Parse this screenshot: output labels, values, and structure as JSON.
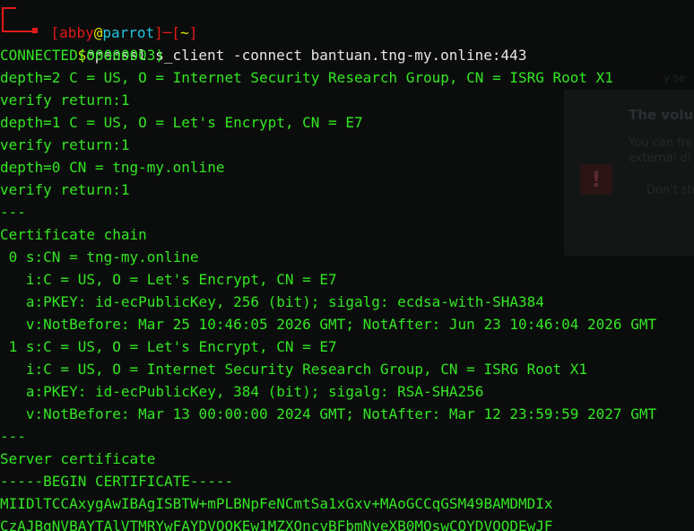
{
  "prompt": {
    "user": "abby",
    "at": "@",
    "host": "parrot",
    "dir": "~",
    "symbol": "$",
    "command": "openssl s_client -connect bantuan.tng-my.online:443"
  },
  "output": [
    "CONNECTED(00000003)",
    "depth=2 C = US, O = Internet Security Research Group, CN = ISRG Root X1",
    "verify return:1",
    "depth=1 C = US, O = Let's Encrypt, CN = E7",
    "verify return:1",
    "depth=0 CN = tng-my.online",
    "verify return:1",
    "---",
    "Certificate chain",
    " 0 s:CN = tng-my.online",
    "   i:C = US, O = Let's Encrypt, CN = E7",
    "   a:PKEY: id-ecPublicKey, 256 (bit); sigalg: ecdsa-with-SHA384",
    "   v:NotBefore: Mar 25 10:46:05 2026 GMT; NotAfter: Jun 23 10:46:04 2026 GMT",
    " 1 s:C = US, O = Let's Encrypt, CN = E7",
    "   i:C = US, O = Internet Security Research Group, CN = ISRG Root X1",
    "   a:PKEY: id-ecPublicKey, 384 (bit); sigalg: RSA-SHA256",
    "   v:NotBefore: Mar 13 00:00:00 2024 GMT; NotAfter: Mar 12 23:59:59 2027 GMT",
    "---",
    "Server certificate",
    "-----BEGIN CERTIFICATE-----",
    "MIIDlTCCAxygAwIBAgISBTW+mPLBNpFeNCmtSa1xGxv+MAoGCCqGSM49BAMDMDIx",
    "CzAJBgNVBAYTAlVTMRYwFAYDVQQKEw1MZXQncyBFbmNyeXB0MQswCQYDVQQDEwJF"
  ],
  "background_window": {
    "title": "The volu",
    "text_line_1": "You can fre",
    "text_line_2": "external di",
    "option": "Don't sh",
    "warning_icon_glyph": "!",
    "top_text": "y se"
  },
  "colors": {
    "output_text": "#33e623",
    "prompt_frame": "#e11a1a",
    "prompt_at": "#e6e600",
    "prompt_host": "#22c6e0",
    "command_text": "#e6e6e6",
    "background": "#0b0d0c"
  }
}
